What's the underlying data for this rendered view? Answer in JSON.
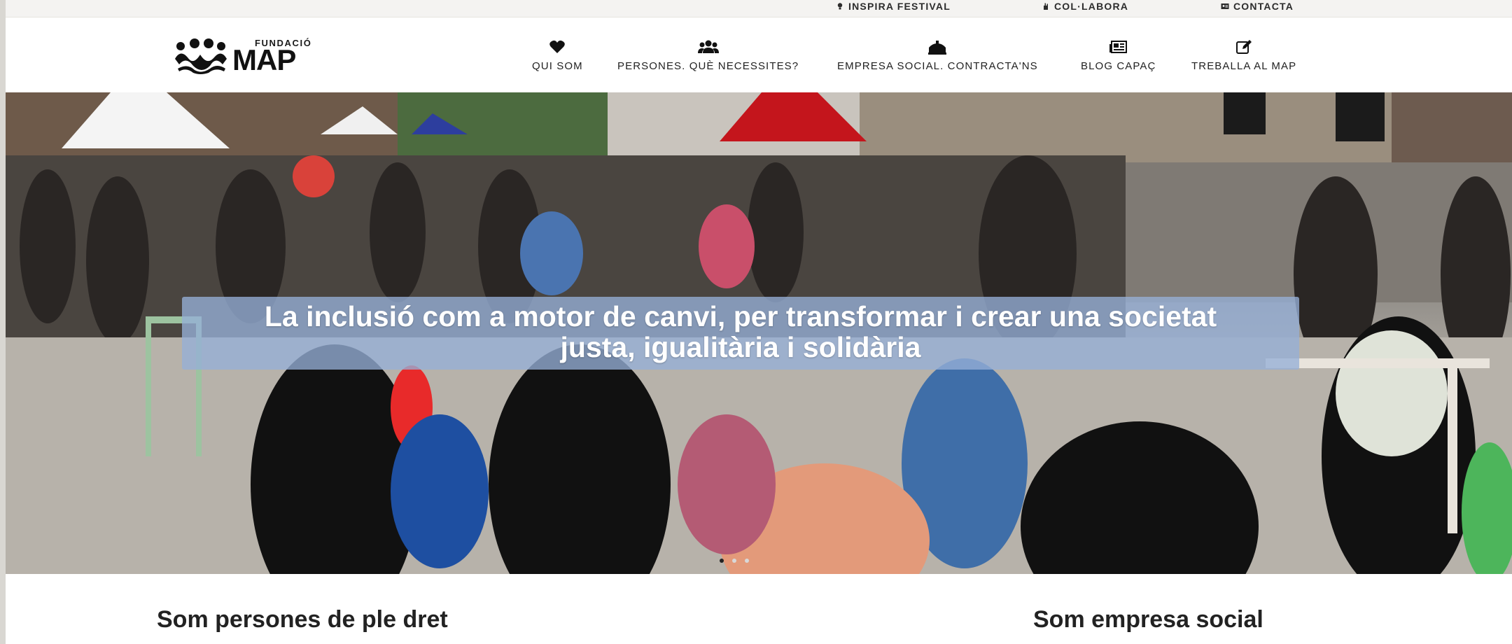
{
  "topbar": {
    "links": [
      {
        "label": "INSPIRA FESTIVAL",
        "icon": "lightbulb-icon"
      },
      {
        "label": "COL·LABORA",
        "icon": "hand-icon"
      },
      {
        "label": "CONTACTA",
        "icon": "address-card-icon"
      }
    ]
  },
  "logo": {
    "small": "FUNDACIÓ",
    "big": "MAP",
    "icon": "people-group-logo"
  },
  "nav": {
    "items": [
      {
        "label": "QUI SOM",
        "icon": "heart-icon"
      },
      {
        "label": "PERSONES. QUÈ NECESSITES?",
        "icon": "users-icon"
      },
      {
        "label": "EMPRESA SOCIAL. CONTRACTA'NS",
        "icon": "industry-icon"
      },
      {
        "label": "BLOG CAPAÇ",
        "icon": "newspaper-icon"
      },
      {
        "label": "TREBALLA AL MAP",
        "icon": "edit-icon"
      }
    ]
  },
  "hero": {
    "caption_line1": "La inclusió com a motor de canvi, per transformar i crear una societat",
    "caption_line2": "justa, igualitària i solidària",
    "slides_count": 3,
    "active_slide": 1,
    "caption_bg": "#96afd7"
  },
  "sections": {
    "left_title": "Som persones de ple dret",
    "right_title": "Som empresa social"
  }
}
